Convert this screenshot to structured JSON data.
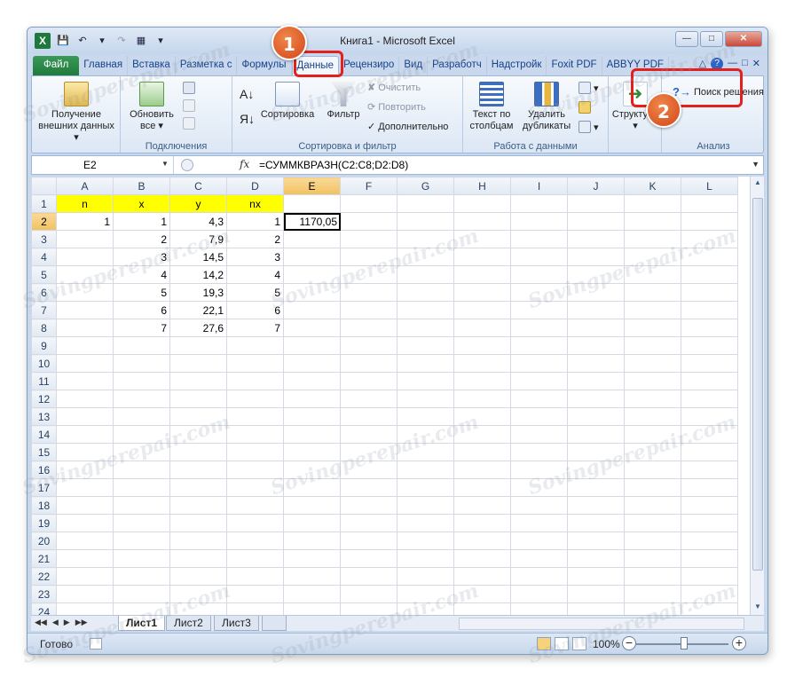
{
  "window": {
    "title": "Книга1  -  Microsoft Excel",
    "app_icon": "X"
  },
  "ribbon_tabs": [
    {
      "label": "Файл",
      "kind": "file"
    },
    {
      "label": "Главная"
    },
    {
      "label": "Вставка"
    },
    {
      "label": "Разметка с"
    },
    {
      "label": "Формулы"
    },
    {
      "label": "Данные",
      "active": true
    },
    {
      "label": "Рецензиро"
    },
    {
      "label": "Вид"
    },
    {
      "label": "Разработч"
    },
    {
      "label": "Надстройк"
    },
    {
      "label": "Foxit PDF"
    },
    {
      "label": "ABBYY PDF"
    }
  ],
  "ribbon": {
    "groups": {
      "get_external_label": "Получение внешних данных",
      "connections_label": "Подключения",
      "sort_filter_label": "Сортировка и фильтр",
      "data_tools_label": "Работа с данными",
      "analysis_label": "Анализ"
    },
    "buttons": {
      "get_external_line1": "Получение",
      "get_external_line2": "внешних данных",
      "refresh_all_line1": "Обновить",
      "refresh_all_line2": "все",
      "sort": "Сортировка",
      "filter": "Фильтр",
      "clear": "Очистить",
      "reapply": "Повторить",
      "advanced": "Дополнительно",
      "text_to_columns_line1": "Текст по",
      "text_to_columns_line2": "столбцам",
      "remove_duplicates_line1": "Удалить",
      "remove_duplicates_line2": "дубликаты",
      "outline": "Структура",
      "solver": "Поиск решения"
    }
  },
  "formula_bar": {
    "name_box": "E2",
    "fx": "fx",
    "formula": "=СУММКВРАЗН(C2:C8;D2:D8)"
  },
  "grid": {
    "columns": [
      "A",
      "B",
      "C",
      "D",
      "E",
      "F",
      "G",
      "H",
      "I",
      "J",
      "K",
      "L"
    ],
    "selected_column": "E",
    "selected_row": 2,
    "row_count": 24,
    "rows": [
      [
        "n",
        "x",
        "y",
        "nx",
        ""
      ],
      [
        "1",
        "1",
        "4,3",
        "1",
        "1170,05"
      ],
      [
        "",
        "2",
        "7,9",
        "2",
        ""
      ],
      [
        "",
        "3",
        "14,5",
        "3",
        ""
      ],
      [
        "",
        "4",
        "14,2",
        "4",
        ""
      ],
      [
        "",
        "5",
        "19,3",
        "5",
        ""
      ],
      [
        "",
        "6",
        "22,1",
        "6",
        ""
      ],
      [
        "",
        "7",
        "27,6",
        "7",
        ""
      ]
    ],
    "header_fill": "#ffff00"
  },
  "sheet_tabs": [
    "Лист1",
    "Лист2",
    "Лист3"
  ],
  "status": {
    "ready": "Готово",
    "zoom": "100%"
  },
  "annotations": {
    "step1": "1",
    "step2": "2",
    "color": "#e3201b"
  },
  "watermark": "Sovingperepair.com"
}
